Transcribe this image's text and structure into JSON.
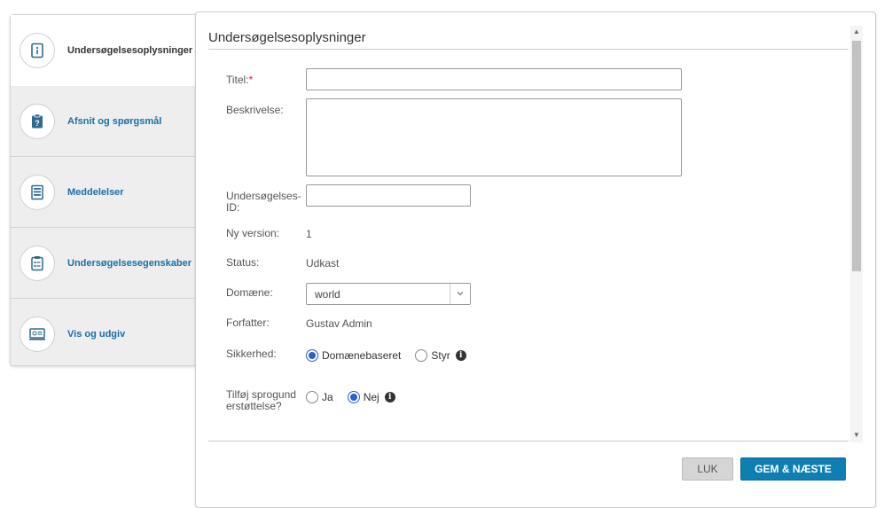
{
  "sidebar": {
    "items": [
      {
        "label": "Undersøgelsesoplysninger",
        "icon": "info-document-icon",
        "active": true
      },
      {
        "label": "Afsnit og spørgsmål",
        "icon": "question-clipboard-icon",
        "active": false
      },
      {
        "label": "Meddelelser",
        "icon": "message-list-icon",
        "active": false
      },
      {
        "label": "Undersøgelsesegenskaber",
        "icon": "properties-document-icon",
        "active": false
      },
      {
        "label": "Vis og udgiv",
        "icon": "monitor-preview-icon",
        "active": false
      }
    ]
  },
  "panel": {
    "title": "Undersøgelsesoplysninger"
  },
  "form": {
    "title_label": "Titel:",
    "title_required_marker": "*",
    "title_value": "",
    "description_label": "Beskrivelse:",
    "description_value": "",
    "survey_id_label": "Undersøgelses-ID:",
    "survey_id_value": "",
    "new_version_label": "Ny version:",
    "new_version_value": "1",
    "status_label": "Status:",
    "status_value": "Udkast",
    "domain_label": "Domæne:",
    "domain_value": "world",
    "author_label": "Forfatter:",
    "author_value": "Gustav Admin",
    "security_label": "Sikkerhed:",
    "security_options": [
      {
        "label": "Domænebaseret",
        "checked": true
      },
      {
        "label": "Styr",
        "checked": false
      }
    ],
    "language_label": "Tilføj sprogunderstøttelse?",
    "language_options": [
      {
        "label": "Ja",
        "checked": false
      },
      {
        "label": "Nej",
        "checked": true
      }
    ]
  },
  "buttons": {
    "close_label": "LUK",
    "save_next_label": "GEM & NÆSTE"
  },
  "colors": {
    "accent": "#0e7fb4",
    "link": "#1a6fa3",
    "required": "#d9233c",
    "radio": "#2a60c8"
  }
}
